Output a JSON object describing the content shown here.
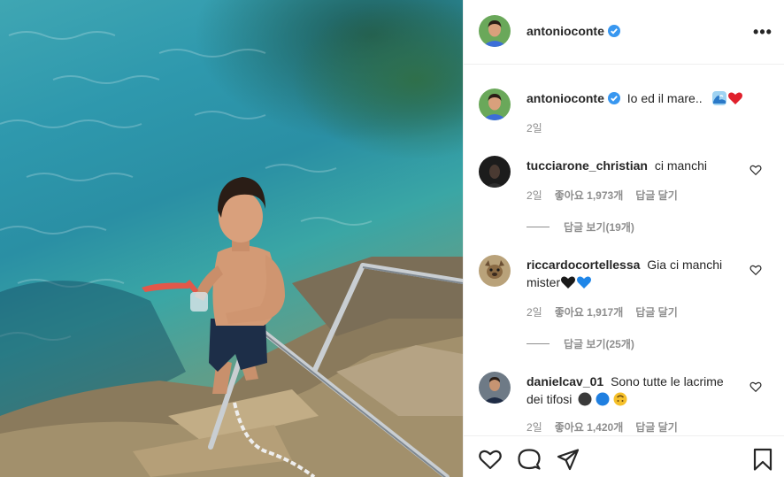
{
  "post": {
    "username": "antonioconte",
    "verified_icon": "verified-badge-icon",
    "more_icon": "more-options-icon"
  },
  "caption": {
    "username": "antonioconte",
    "text": "Io ed il mare..",
    "emojis": [
      "wave-emoji",
      "red-heart-emoji"
    ],
    "time": "2일"
  },
  "comments": [
    {
      "username": "tucciarone_christian",
      "text": "ci manchi",
      "time": "2일",
      "likes": "좋아요 1,973개",
      "reply_label": "답글 달기",
      "view_replies": "답글 보기(19개)"
    },
    {
      "username": "riccardocortellessa",
      "text": "Gia ci manchi",
      "text_line2": "mister",
      "emojis": [
        "black-heart-emoji",
        "blue-heart-emoji"
      ],
      "time": "2일",
      "likes": "좋아요 1,917개",
      "reply_label": "답글 달기",
      "view_replies": "답글 보기(25개)"
    },
    {
      "username": "danielcav_01",
      "text": "Sono tutte le lacrime",
      "text_line2": "dei tifosi",
      "emojis": [
        "black-circle-emoji",
        "blue-circle-emoji",
        "upside-down-face-emoji"
      ],
      "time": "2일",
      "likes": "좋아요 1,420개",
      "reply_label": "답글 달기"
    }
  ],
  "actions": {
    "icons": [
      "heart-icon",
      "comment-icon",
      "share-icon",
      "bookmark-icon"
    ]
  },
  "colors": {
    "text": "#262626",
    "secondary": "#8e8e8e",
    "verified": "#3897f0",
    "border": "#efefef"
  }
}
